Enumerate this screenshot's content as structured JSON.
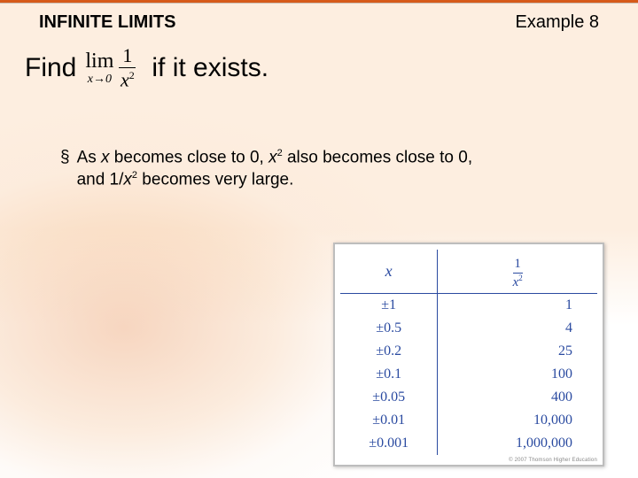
{
  "header": {
    "section": "INFINITE LIMITS",
    "example": "Example 8"
  },
  "prompt": {
    "find": "Find",
    "lim": "lim",
    "lim_sub_left": "x",
    "lim_sub_arrow": "→",
    "lim_sub_right": "0",
    "frac_num": "1",
    "frac_den_base": "x",
    "frac_den_exp": "2",
    "tail": "if it exists."
  },
  "bullet": {
    "marker": "§",
    "t1": "As ",
    "var_x": "x",
    "t2": " becomes close to 0, ",
    "xsq_base": "x",
    "xsq_exp": "2",
    "t3": " also becomes close to 0,",
    "t4": "and 1/",
    "inv_base": "x",
    "inv_exp": "2",
    "t5": " becomes very large."
  },
  "table": {
    "col1_header": "x",
    "col2_frac_num": "1",
    "col2_frac_den_base": "x",
    "col2_frac_den_exp": "2",
    "rows": [
      {
        "x": "±1",
        "v": "1"
      },
      {
        "x": "±0.5",
        "v": "4"
      },
      {
        "x": "±0.2",
        "v": "25"
      },
      {
        "x": "±0.1",
        "v": "100"
      },
      {
        "x": "±0.05",
        "v": "400"
      },
      {
        "x": "±0.01",
        "v": "10,000"
      },
      {
        "x": "±0.001",
        "v": "1,000,000"
      }
    ],
    "copyright": "© 2007 Thomson Higher Education"
  },
  "chart_data": {
    "type": "table",
    "title": "Values of 1/x^2 as x approaches 0",
    "columns": [
      "x",
      "1/x^2"
    ],
    "rows": [
      [
        "±1",
        1
      ],
      [
        "±0.5",
        4
      ],
      [
        "±0.2",
        25
      ],
      [
        "±0.1",
        100
      ],
      [
        "±0.05",
        400
      ],
      [
        "±0.01",
        10000
      ],
      [
        "±0.001",
        1000000
      ]
    ]
  }
}
